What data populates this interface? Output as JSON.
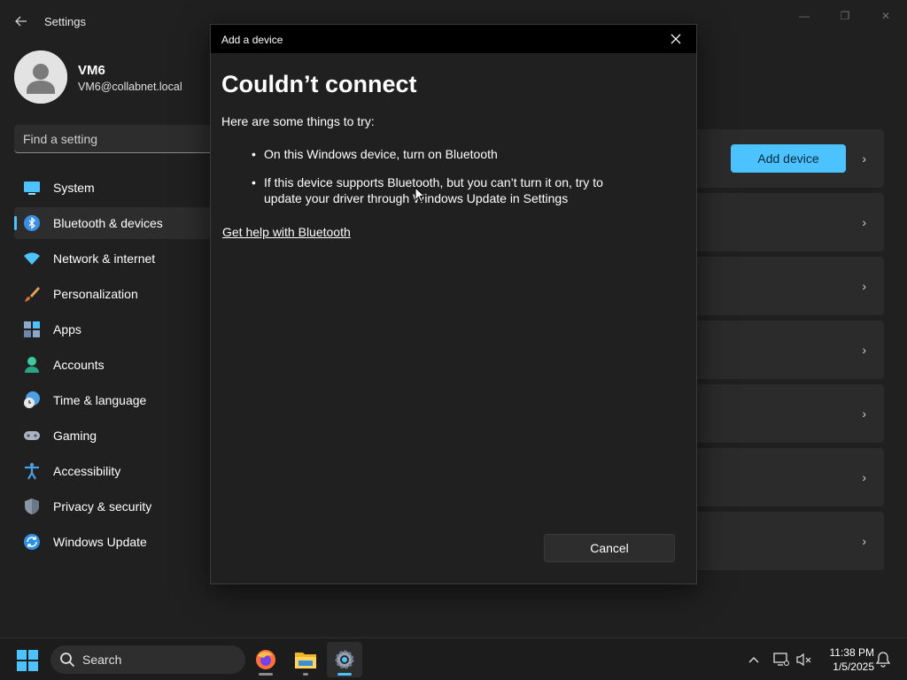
{
  "app": {
    "title": "Settings"
  },
  "window_controls": {
    "minimize": "—",
    "maximize": "❐",
    "close": "✕"
  },
  "profile": {
    "name": "VM6",
    "email": "VM6@collabnet.local"
  },
  "search": {
    "placeholder": "Find a setting"
  },
  "nav": {
    "items": [
      {
        "label": "System",
        "icon": "system-icon",
        "active": false
      },
      {
        "label": "Bluetooth & devices",
        "icon": "bluetooth-icon",
        "active": true
      },
      {
        "label": "Network & internet",
        "icon": "wifi-icon",
        "active": false
      },
      {
        "label": "Personalization",
        "icon": "brush-icon",
        "active": false
      },
      {
        "label": "Apps",
        "icon": "apps-icon",
        "active": false
      },
      {
        "label": "Accounts",
        "icon": "accounts-icon",
        "active": false
      },
      {
        "label": "Time & language",
        "icon": "clock-globe-icon",
        "active": false
      },
      {
        "label": "Gaming",
        "icon": "gamepad-icon",
        "active": false
      },
      {
        "label": "Accessibility",
        "icon": "accessibility-icon",
        "active": false
      },
      {
        "label": "Privacy & security",
        "icon": "shield-icon",
        "active": false
      },
      {
        "label": "Windows Update",
        "icon": "update-icon",
        "active": false
      }
    ]
  },
  "content": {
    "add_device_label": "Add device",
    "chevron": "›"
  },
  "dialog": {
    "title": "Add a device",
    "heading": "Couldn’t connect",
    "intro": "Here are some things to try:",
    "tips": [
      "On this Windows device, turn on Bluetooth",
      "If this device supports Bluetooth, but you can’t turn it on, try to update your driver through Windows Update in Settings"
    ],
    "help_link": "Get help with Bluetooth",
    "cancel_label": "Cancel"
  },
  "taskbar": {
    "search_label": "Search",
    "apps": [
      "firefox-icon",
      "file-explorer-icon",
      "settings-icon"
    ],
    "clock_time": "11:38 PM",
    "clock_date": "1/5/2025"
  },
  "colors": {
    "accent": "#4cc2ff",
    "background": "#202020",
    "dialog_titlebar": "#000000"
  }
}
